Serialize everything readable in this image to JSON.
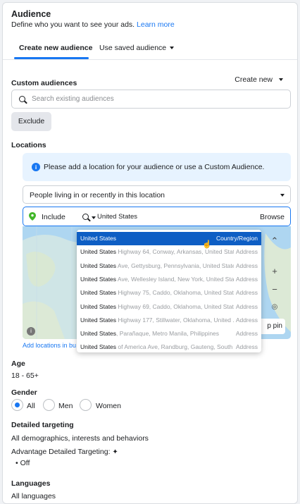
{
  "header": {
    "title": "Audience",
    "subtitle": "Define who you want to see your ads.",
    "learn_more": "Learn more"
  },
  "tabs": [
    {
      "label": "Create new audience",
      "active": true
    },
    {
      "label": "Use saved audience",
      "active": false
    }
  ],
  "custom_audiences": {
    "label": "Custom audiences",
    "create_new": "Create new",
    "search_placeholder": "Search existing audiences",
    "exclude": "Exclude"
  },
  "locations": {
    "label": "Locations",
    "info": "Please add a location for your audience or use a Custom Audience.",
    "location_type": "People living in or recently in this location",
    "include": "Include",
    "query": "United States",
    "browse": "Browse",
    "drop_pin": "p pin",
    "add_bulk": "Add locations in bulk",
    "suggestions": [
      {
        "name": "United States",
        "detail": "",
        "type": "Country/Region",
        "selected": true
      },
      {
        "name": "United States",
        "detail": " Highway 64, Conway, Arkansas, United Stat...",
        "type": "Address",
        "selected": false
      },
      {
        "name": "United States",
        "detail": " Ave, Gettysburg, Pennsylvania, United States",
        "type": "Address",
        "selected": false
      },
      {
        "name": "United States",
        "detail": " Ave, Wellesley Island, New York, United Sta...",
        "type": "Address",
        "selected": false
      },
      {
        "name": "United States",
        "detail": " Highway 75, Caddo, Oklahoma, United Stat...",
        "type": "Address",
        "selected": false
      },
      {
        "name": "United States",
        "detail": " Highway 69, Caddo, Oklahoma, United Stat...",
        "type": "Address",
        "selected": false
      },
      {
        "name": "United States",
        "detail": " Highway 177, Stillwater, Oklahoma, United ...",
        "type": "Address",
        "selected": false
      },
      {
        "name": "United States",
        "detail": ", Parañaque, Metro Manila, Philippines",
        "type": "Address",
        "selected": false
      },
      {
        "name": "United States",
        "detail": " of America Ave, Randburg, Gauteng, South ...",
        "type": "Address",
        "selected": false
      }
    ]
  },
  "age": {
    "label": "Age",
    "value": "18 - 65+"
  },
  "gender": {
    "label": "Gender",
    "options": [
      "All",
      "Men",
      "Women"
    ],
    "selected": "All"
  },
  "detailed_targeting": {
    "label": "Detailed targeting",
    "value": "All demographics, interests and behaviors",
    "advantage": "Advantage Detailed Targeting:",
    "advantage_value": "• Off"
  },
  "languages": {
    "label": "Languages",
    "value": "All languages"
  },
  "colors": {
    "accent": "#1877f2",
    "selected_row": "#0e5ec4",
    "info_bg": "#e7f3ff",
    "pin": "#42b72a"
  }
}
